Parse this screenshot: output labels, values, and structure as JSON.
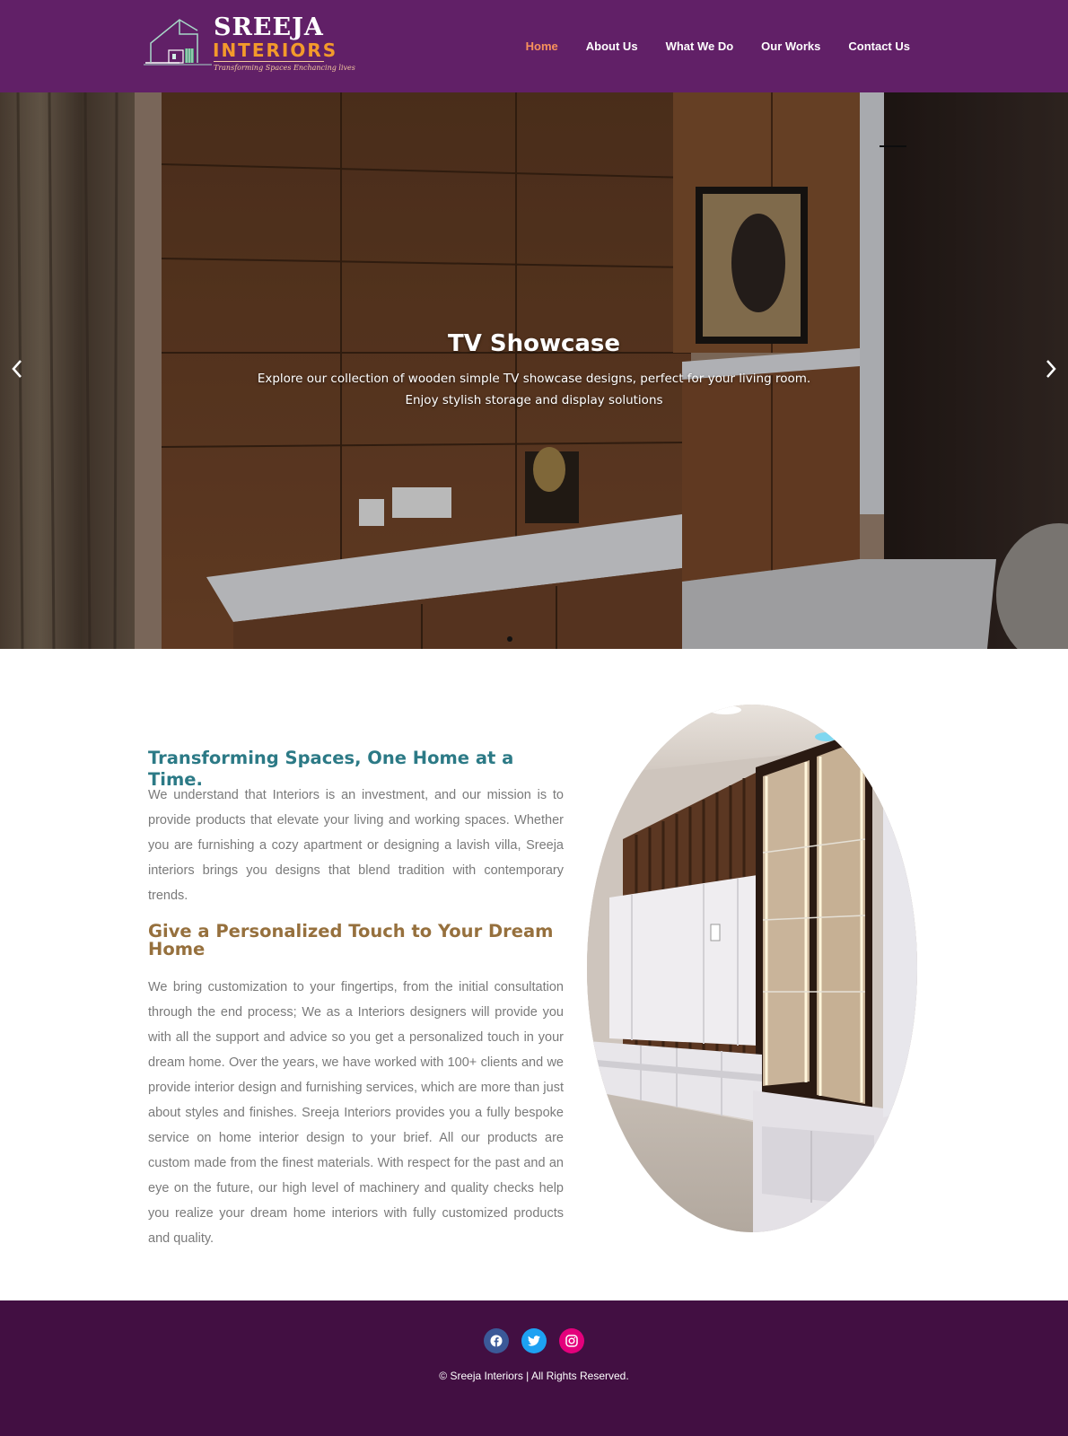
{
  "header": {
    "logo": {
      "name": "SREEJA",
      "sub": "INTERIORS",
      "tagline": "Transforming Spaces Enchancing lives"
    },
    "nav": [
      {
        "label": "Home",
        "active": true
      },
      {
        "label": "About Us",
        "active": false
      },
      {
        "label": "What We Do",
        "active": false
      },
      {
        "label": "Our Works",
        "active": false
      },
      {
        "label": "Contact Us",
        "active": false
      }
    ]
  },
  "hero": {
    "title": "TV Showcase",
    "description_line1": "Explore our collection of wooden simple TV showcase designs, perfect for your living room.",
    "description_line2": "Enjoy stylish storage and display solutions",
    "prev_icon": "chevron-left-icon",
    "next_icon": "chevron-right-icon"
  },
  "about": {
    "heading1": "Transforming Spaces, One Home at a Time.",
    "paragraph1": "We understand that Interiors is an investment, and our mission is to provide products that elevate your living and working spaces. Whether you are furnishing a cozy apartment or designing a lavish villa, Sreeja interiors brings you designs that blend tradition with contemporary trends.",
    "heading2": "Give a Personalized Touch to Your Dream Home",
    "paragraph2": "We bring customization to your fingertips, from the initial consultation through the end process; We as a Interiors designers will provide you with all the support and advice so you get a personalized touch in your dream home. Over the years, we have worked with 100+ clients and we provide interior design and furnishing services, which are more than just about styles and finishes. Sreeja Interiors provides you a fully bespoke service on home interior design to your brief. All our products are custom made from the finest materials. With respect for the past and an eye on the future, our high level of machinery and quality checks help you realize your dream home interiors with fully customized products and quality."
  },
  "footer": {
    "socials": [
      {
        "icon": "facebook-icon",
        "color": "#3b5998"
      },
      {
        "icon": "twitter-icon",
        "color": "#1da1f2"
      },
      {
        "icon": "instagram-icon",
        "color": "#e4007c"
      }
    ],
    "copyright": "© Sreeja Interiors | All Rights Reserved."
  },
  "colors": {
    "header_bg": "#612067",
    "footer_bg": "#420f42",
    "nav_active": "#f7915c",
    "heading_teal": "#2c7a86",
    "heading_brown": "#96703d"
  }
}
